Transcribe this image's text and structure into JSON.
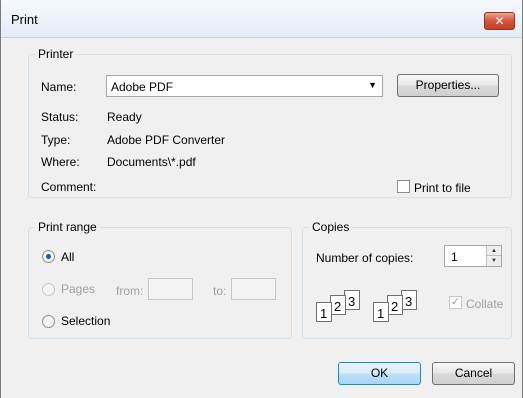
{
  "window": {
    "title": "Print",
    "close_glyph": "✕"
  },
  "printer": {
    "group_label": "Printer",
    "name_label": "Name:",
    "name_value": "Adobe PDF",
    "properties_label": "Properties...",
    "status_label": "Status:",
    "status_value": "Ready",
    "type_label": "Type:",
    "type_value": "Adobe PDF Converter",
    "where_label": "Where:",
    "where_value": "Documents\\*.pdf",
    "comment_label": "Comment:",
    "print_to_file_label": "Print to file",
    "print_to_file_checked": false
  },
  "range": {
    "group_label": "Print range",
    "all_label": "All",
    "pages_label": "Pages",
    "from_label": "from:",
    "to_label": "to:",
    "from_value": "",
    "to_value": "",
    "selection_label": "Selection",
    "selected": "All"
  },
  "copies": {
    "group_label": "Copies",
    "number_label": "Number of copies:",
    "number_value": "1",
    "collate_label": "Collate",
    "collate_checked": true,
    "collate_pages": [
      "1",
      "2",
      "3"
    ]
  },
  "buttons": {
    "ok_label": "OK",
    "cancel_label": "Cancel"
  },
  "icons": {
    "dropdown": "dropdown-arrow-icon",
    "spin_up": "spin-up-icon",
    "spin_down": "spin-down-icon",
    "collate": "collate-pages-icon"
  }
}
